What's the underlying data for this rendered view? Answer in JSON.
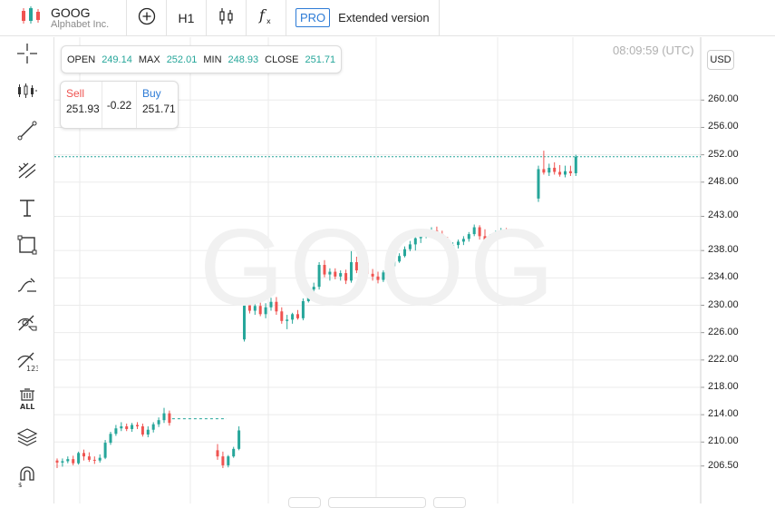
{
  "header": {
    "symbol": "GOOG",
    "company": "Alphabet Inc.",
    "timeframe": "H1",
    "pro_badge": "PRO",
    "extended_label": "Extended version",
    "icons": [
      "candles-logo-icon",
      "add-indicator-icon",
      "candlestick-type-icon",
      "function-icon"
    ]
  },
  "toolbar_icons": [
    "crosshair-icon",
    "indicators-icon",
    "trendline-icon",
    "fib-tool-icon",
    "text-icon",
    "rectangle-icon",
    "brush-icon",
    "hide-drawings-icon",
    "hide-values-icon",
    "delete-all-icon",
    "layers-icon",
    "magnet-icon"
  ],
  "ohlc": {
    "open_label": "OPEN",
    "open": "249.14",
    "max_label": "MAX",
    "max": "252.01",
    "min_label": "MIN",
    "min": "248.93",
    "close_label": "CLOSE",
    "close": "251.71"
  },
  "trade": {
    "sell_label": "Sell",
    "sell_price": "251.93",
    "spread": "-0.22",
    "buy_label": "Buy",
    "buy_price": "251.71"
  },
  "chart_meta": {
    "time": "08:09:59 (UTC)",
    "currency": "USD",
    "watermark": "GOOG"
  },
  "colors": {
    "up": "#26a69a",
    "down": "#ef5350",
    "accent": "#2d7bd6"
  },
  "chart_data": {
    "type": "candlestick",
    "y_ticks": [
      "260.00",
      "256.00",
      "252.00",
      "248.00",
      "243.00",
      "238.00",
      "234.00",
      "230.00",
      "226.00",
      "222.00",
      "218.00",
      "214.00",
      "210.00",
      "206.50"
    ],
    "current_price": 251.71,
    "candles": [
      [
        207.3,
        207.6,
        206.2,
        207.0
      ],
      [
        207.0,
        207.6,
        206.4,
        207.2
      ],
      [
        207.2,
        207.9,
        206.9,
        207.5
      ],
      [
        207.5,
        208.0,
        206.6,
        206.9
      ],
      [
        206.9,
        208.6,
        206.7,
        208.4
      ],
      [
        208.4,
        208.9,
        207.3,
        207.9
      ],
      [
        207.9,
        208.5,
        207.1,
        207.4
      ],
      [
        207.4,
        207.9,
        206.8,
        207.3
      ],
      [
        207.3,
        208.2,
        207.0,
        207.7
      ],
      [
        207.7,
        210.3,
        207.5,
        209.9
      ],
      [
        209.9,
        211.5,
        209.6,
        211.2
      ],
      [
        211.2,
        212.5,
        210.9,
        212.0
      ],
      [
        212.0,
        212.9,
        211.6,
        212.3
      ],
      [
        212.3,
        212.7,
        211.6,
        211.9
      ],
      [
        211.9,
        212.8,
        211.5,
        212.5
      ],
      [
        212.5,
        212.9,
        211.9,
        212.3
      ],
      [
        212.3,
        212.7,
        210.8,
        211.1
      ],
      [
        211.1,
        212.3,
        210.7,
        211.8
      ],
      [
        211.8,
        212.9,
        211.4,
        212.6
      ],
      [
        212.6,
        213.6,
        212.2,
        213.2
      ],
      [
        213.2,
        215.0,
        212.8,
        214.2
      ],
      [
        214.2,
        214.6,
        212.4,
        212.8
      ],
      null,
      null,
      null,
      null,
      null,
      null,
      null,
      null,
      [
        208.8,
        209.7,
        207.4,
        207.9
      ],
      [
        207.9,
        208.6,
        206.2,
        206.6
      ],
      [
        206.6,
        208.1,
        206.3,
        207.9
      ],
      [
        207.9,
        209.3,
        207.7,
        209.0
      ],
      [
        209.0,
        212.3,
        208.8,
        211.7
      ],
      [
        225.0,
        230.4,
        224.7,
        230.0
      ],
      [
        230.0,
        230.7,
        228.8,
        229.2
      ],
      [
        229.2,
        230.4,
        228.6,
        229.9
      ],
      [
        229.9,
        231.0,
        228.4,
        228.7
      ],
      [
        228.7,
        230.3,
        228.1,
        229.7
      ],
      [
        229.7,
        231.1,
        229.2,
        230.5
      ],
      [
        230.5,
        231.2,
        228.6,
        229.1
      ],
      [
        229.1,
        229.7,
        227.3,
        227.7
      ],
      [
        227.7,
        228.6,
        226.5,
        227.9
      ],
      [
        227.9,
        228.9,
        227.3,
        228.7
      ],
      [
        228.7,
        229.3,
        227.9,
        228.1
      ],
      [
        228.1,
        231.0,
        227.8,
        230.6
      ],
      [
        230.6,
        232.8,
        230.4,
        232.3
      ],
      [
        232.3,
        233.3,
        231.8,
        232.7
      ],
      [
        232.7,
        236.3,
        232.3,
        235.9
      ],
      [
        235.9,
        236.6,
        234.1,
        234.5
      ],
      [
        234.5,
        235.4,
        233.6,
        234.9
      ],
      [
        234.9,
        235.4,
        233.8,
        234.2
      ],
      [
        234.2,
        235.1,
        233.6,
        234.7
      ],
      [
        234.7,
        235.2,
        233.1,
        233.6
      ],
      [
        233.6,
        237.9,
        233.3,
        236.3
      ],
      [
        236.3,
        237.1,
        234.7,
        235.1
      ],
      [
        235.1,
        236.7,
        234.6,
        236.2
      ],
      [
        236.2,
        236.5,
        234.2,
        234.6
      ],
      [
        234.6,
        235.3,
        233.6,
        234.2
      ],
      [
        234.2,
        234.9,
        233.2,
        233.7
      ],
      [
        233.7,
        235.1,
        233.4,
        234.8
      ],
      [
        234.8,
        236.1,
        234.6,
        235.7
      ],
      [
        235.7,
        236.7,
        235.2,
        236.4
      ],
      [
        236.4,
        237.6,
        236.2,
        237.2
      ],
      [
        237.2,
        238.6,
        237.0,
        238.2
      ],
      [
        238.2,
        239.4,
        237.9,
        238.9
      ],
      [
        238.9,
        240.1,
        238.0,
        239.8
      ],
      [
        239.8,
        240.4,
        239.1,
        240.2
      ],
      [
        240.2,
        241.1,
        239.8,
        240.8
      ],
      [
        240.8,
        241.4,
        239.9,
        240.9
      ],
      [
        240.9,
        241.5,
        240.0,
        240.4
      ],
      [
        240.4,
        240.9,
        239.1,
        239.5
      ],
      [
        239.5,
        240.0,
        237.6,
        238.0
      ],
      [
        238.0,
        239.2,
        236.3,
        238.8
      ],
      [
        238.8,
        239.6,
        238.3,
        239.3
      ],
      [
        239.3,
        240.1,
        238.8,
        239.7
      ],
      [
        239.7,
        240.7,
        239.3,
        240.4
      ],
      [
        240.4,
        241.8,
        240.1,
        241.4
      ],
      [
        241.4,
        241.7,
        239.6,
        240.1
      ],
      [
        240.1,
        241.1,
        238.4,
        238.9
      ],
      [
        238.9,
        240.4,
        238.6,
        240.0
      ],
      [
        240.0,
        240.9,
        239.6,
        240.6
      ],
      [
        240.6,
        241.3,
        240.2,
        241.0
      ],
      [
        241.0,
        241.3,
        240.1,
        240.6
      ],
      [
        240.6,
        241.2,
        240.2,
        240.8
      ],
      null,
      null,
      null,
      null,
      [
        245.6,
        250.4,
        245.1,
        249.9
      ],
      [
        249.9,
        252.6,
        249.1,
        249.4
      ],
      [
        249.4,
        250.7,
        248.9,
        250.1
      ],
      [
        250.1,
        250.9,
        249.1,
        249.5
      ],
      [
        249.5,
        250.5,
        248.8,
        249.1
      ],
      [
        249.1,
        250.4,
        248.7,
        249.6
      ],
      [
        249.6,
        250.4,
        248.9,
        249.3
      ],
      [
        249.3,
        252.0,
        248.9,
        251.71
      ]
    ],
    "ref_line_value": 213.4
  }
}
